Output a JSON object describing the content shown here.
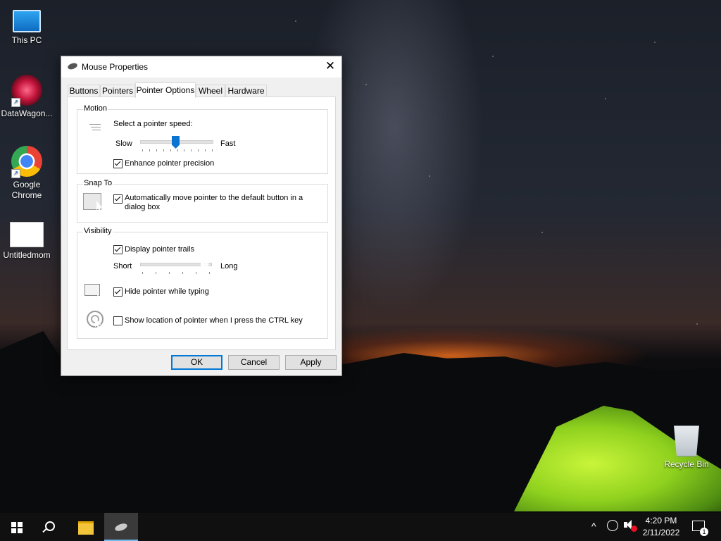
{
  "desktop": {
    "icons": [
      {
        "label": "This PC"
      },
      {
        "label": "DataWagon..."
      },
      {
        "label": "Google Chrome"
      },
      {
        "label": "Untitledmom"
      },
      {
        "label": "Recycle Bin"
      }
    ]
  },
  "dialog": {
    "title": "Mouse Properties",
    "close_glyph": "✕",
    "tabs": [
      {
        "label": "Buttons",
        "active": false
      },
      {
        "label": "Pointers",
        "active": false
      },
      {
        "label": "Pointer Options",
        "active": true
      },
      {
        "label": "Wheel",
        "active": false
      },
      {
        "label": "Hardware",
        "active": false
      }
    ],
    "motion": {
      "group_label": "Motion",
      "prompt": "Select a pointer speed:",
      "slow_label": "Slow",
      "fast_label": "Fast",
      "speed_level": 0.5,
      "enhance_label": "Enhance pointer precision",
      "enhance_checked": true
    },
    "snap_to": {
      "group_label": "Snap To",
      "label": "Automatically move pointer to the default button in a dialog box",
      "checked": true
    },
    "visibility": {
      "group_label": "Visibility",
      "trails_label": "Display pointer trails",
      "trails_checked": true,
      "short_label": "Short",
      "long_label": "Long",
      "trail_level": 1.0,
      "hide_label": "Hide pointer while typing",
      "hide_checked": true,
      "show_location_label": "Show location of pointer when I press the CTRL key",
      "show_location_checked": false
    },
    "buttons": {
      "ok": "OK",
      "cancel": "Cancel",
      "apply": "Apply"
    }
  },
  "taskbar": {
    "time": "4:20 PM",
    "date": "2/11/2022",
    "notification_count": "1",
    "tray_chevron": "^"
  },
  "colors": {
    "accent": "#0078d7",
    "slider_thumb": "#0b74d1",
    "taskbar": "#101010",
    "dialog_bg": "#f0f0f0"
  }
}
